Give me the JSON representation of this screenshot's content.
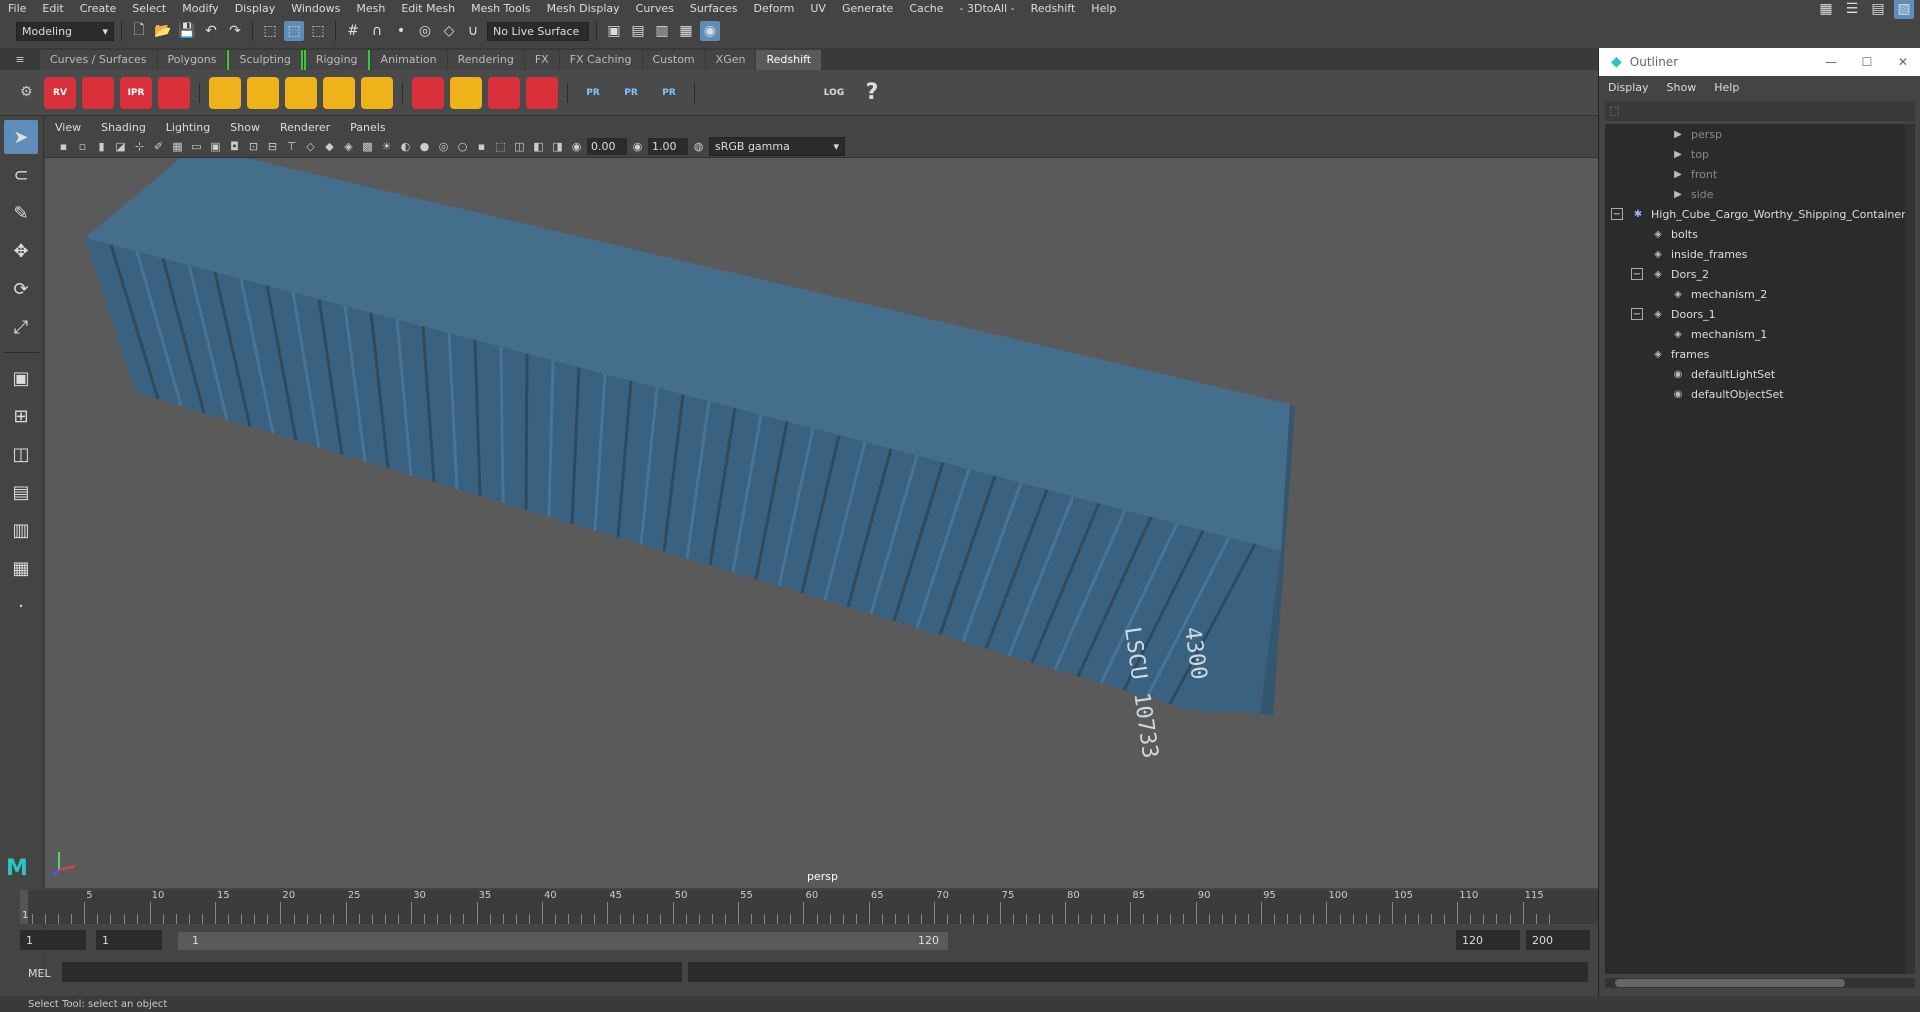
{
  "menubar": {
    "items": [
      "File",
      "Edit",
      "Create",
      "Select",
      "Modify",
      "Display",
      "Windows",
      "Mesh",
      "Edit Mesh",
      "Mesh Tools",
      "Mesh Display",
      "Curves",
      "Surfaces",
      "Deform",
      "UV",
      "Generate",
      "Cache",
      "- 3DtoAll -",
      "Redshift",
      "Help"
    ]
  },
  "statusline": {
    "workspace": "Modeling",
    "live_surface": "No Live Surface"
  },
  "shelf": {
    "tabs": [
      "Curves / Surfaces",
      "Polygons",
      "Sculpting",
      "Rigging",
      "Animation",
      "Rendering",
      "FX",
      "FX Caching",
      "Custom",
      "XGen",
      "Redshift"
    ],
    "active_tab": "Redshift",
    "icons": [
      {
        "name": "redshift-rv-icon",
        "label": "RV",
        "color": "#d9313b"
      },
      {
        "name": "redshift-batch-icon",
        "label": "",
        "color": "#d9313b"
      },
      {
        "name": "redshift-ipr-icon",
        "label": "IPR",
        "color": "#d9313b"
      },
      {
        "name": "redshift-settings-icon",
        "label": "",
        "color": "#d9313b"
      },
      {
        "name": "light-diamond-icon",
        "label": "",
        "color": "#f0b21b"
      },
      {
        "name": "light-grid-icon",
        "label": "",
        "color": "#f0b21b"
      },
      {
        "name": "spotlight-icon",
        "label": "",
        "color": "#f0b21b"
      },
      {
        "name": "dome-light-icon",
        "label": "",
        "color": "#f0b21b"
      },
      {
        "name": "sun-sky-icon",
        "label": "",
        "color": "#f0b21b"
      },
      {
        "name": "rs-cube-icon",
        "label": "",
        "color": "#d9313b"
      },
      {
        "name": "rs-hair-icon",
        "label": "",
        "color": "#f0b21b"
      },
      {
        "name": "rs-curve-icon",
        "label": "",
        "color": "#d9313b"
      },
      {
        "name": "rs-sphere-icon",
        "label": "",
        "color": "#d9313b"
      },
      {
        "name": "proxy-export-icon",
        "label": "PR",
        "color": "#4d7fb0"
      },
      {
        "name": "proxy-import-icon",
        "label": "PR",
        "color": "#4d7fb0"
      },
      {
        "name": "proxy-swap-icon",
        "label": "PR",
        "color": "#4d7fb0"
      },
      {
        "name": "material-bowl-icon",
        "label": "",
        "color": "#cccccc"
      },
      {
        "name": "material-bowl2-icon",
        "label": "",
        "color": "#cccccc"
      },
      {
        "name": "code-window-icon",
        "label": "",
        "color": "#cccccc"
      },
      {
        "name": "log-icon",
        "label": "LOG",
        "color": "#cccccc"
      },
      {
        "name": "help-icon",
        "label": "?",
        "color": "#cccccc"
      }
    ]
  },
  "panel": {
    "menu": [
      "View",
      "Shading",
      "Lighting",
      "Show",
      "Renderer",
      "Panels"
    ],
    "exposure": "0.00",
    "gamma": "1.00",
    "colorspace": "sRGB gamma",
    "camera": "persp"
  },
  "timeline": {
    "ticks": [
      "5",
      "10",
      "15",
      "20",
      "25",
      "30",
      "35",
      "40",
      "45",
      "50",
      "55",
      "60",
      "65",
      "70",
      "75",
      "80",
      "85",
      "90",
      "95",
      "100",
      "105",
      "110",
      "115"
    ],
    "current": "1"
  },
  "range": {
    "start": "1",
    "playback_start": "1",
    "slider_start": "1",
    "slider_end": "120",
    "playback_end": "120",
    "end": "200"
  },
  "cmdline": {
    "label": "MEL"
  },
  "helpline": {
    "text": "Select Tool: select an object"
  },
  "container": {
    "code_a": "LSCU 10733",
    "code_b": "4300",
    "color": "#3e6583"
  },
  "outliner": {
    "title": "Outliner",
    "menu": [
      "Display",
      "Show",
      "Help"
    ],
    "items": [
      {
        "label": "persp",
        "icon": "camera-icon",
        "dim": true
      },
      {
        "label": "top",
        "icon": "camera-icon",
        "dim": true
      },
      {
        "label": "front",
        "icon": "camera-icon",
        "dim": true
      },
      {
        "label": "side",
        "icon": "camera-icon",
        "dim": true
      },
      {
        "label": "High_Cube_Cargo_Worthy_Shipping_Container_",
        "icon": "group-icon",
        "dim": false
      },
      {
        "label": "bolts",
        "icon": "mesh-icon",
        "dim": false
      },
      {
        "label": "inside_frames",
        "icon": "mesh-icon",
        "dim": false
      },
      {
        "label": "Dors_2",
        "icon": "mesh-icon",
        "dim": false
      },
      {
        "label": "mechanism_2",
        "icon": "mesh-icon",
        "dim": false
      },
      {
        "label": "Doors_1",
        "icon": "mesh-icon",
        "dim": false
      },
      {
        "label": "mechanism_1",
        "icon": "mesh-icon",
        "dim": false
      },
      {
        "label": "frames",
        "icon": "mesh-icon",
        "dim": false
      },
      {
        "label": "defaultLightSet",
        "icon": "set-icon",
        "dim": false
      },
      {
        "label": "defaultObjectSet",
        "icon": "set-icon",
        "dim": false
      }
    ]
  }
}
